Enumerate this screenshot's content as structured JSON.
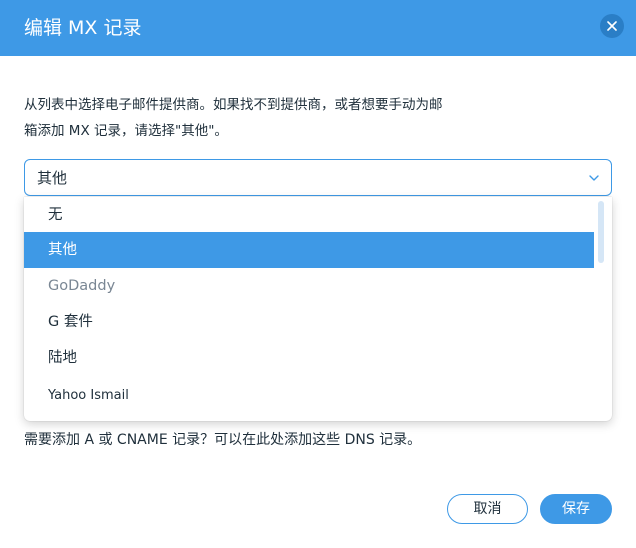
{
  "dialog": {
    "title": "编辑 MX 记录",
    "description": "从列表中选择电子邮件提供商。如果找不到提供商，或者想要手动为邮箱添加 MX 记录，请选择\"其他\"。",
    "select": {
      "value": "其他"
    },
    "options": [
      {
        "label": "无"
      },
      {
        "label": "其他"
      },
      {
        "label": "GoDaddy"
      },
      {
        "label": "G 套件"
      },
      {
        "label": "陆地"
      },
      {
        "label": "Yahoo Ismail"
      }
    ],
    "hint": "需要添加 A 或 CNAME 记录？可以在此处添加这些 DNS 记录。",
    "buttons": {
      "cancel": "取消",
      "save": "保存"
    }
  },
  "colors": {
    "accent": "#3e99e6",
    "header_close_bg": "#2a7ec6",
    "text": "#20303c",
    "muted_text": "#7a8794"
  },
  "icons": {
    "close": "close-icon",
    "chevron": "chevron-down-icon"
  }
}
